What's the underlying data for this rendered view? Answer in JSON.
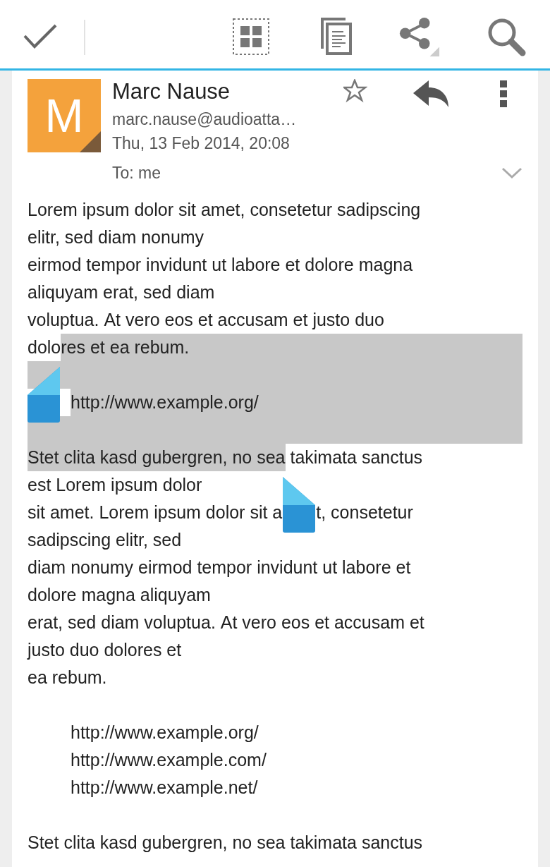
{
  "message": {
    "sender_name": "Marc Nause",
    "avatar_initial": "M",
    "email": "marc.nause@audioatta…",
    "date": "Thu, 13 Feb 2014, 20:08",
    "recipients": "To: me",
    "starred": false
  },
  "body": [
    {
      "kind": "text",
      "segments": [
        {
          "text": "Lorem ipsum dolor sit amet, consetetur sadipscing",
          "selected": false
        }
      ]
    },
    {
      "kind": "text",
      "segments": [
        {
          "text": "elitr, sed diam nonumy",
          "selected": false
        }
      ]
    },
    {
      "kind": "text",
      "segments": [
        {
          "text": "eirmod tempor invidunt ut labore et dolore magna",
          "selected": false
        }
      ]
    },
    {
      "kind": "text",
      "segments": [
        {
          "text": "aliquyam erat, sed diam",
          "selected": false
        }
      ]
    },
    {
      "kind": "text",
      "segments": [
        {
          "text": "voluptua. At vero eos et accusam et justo duo",
          "selected": false
        }
      ]
    },
    {
      "kind": "text",
      "segments": [
        {
          "text": "dolo",
          "selected": false
        },
        {
          "text": "res et ea rebum.",
          "selected": true
        }
      ]
    },
    {
      "kind": "gap",
      "selected": true
    },
    {
      "kind": "url",
      "segments": [
        {
          "text": "http://www.example.org/",
          "selected": true
        }
      ]
    },
    {
      "kind": "gap",
      "selected": true
    },
    {
      "kind": "text",
      "segments": [
        {
          "text": "Stet clita kasd gubergren, no sea",
          "selected": true
        },
        {
          "text": " takimata sanctus",
          "selected": false
        }
      ]
    },
    {
      "kind": "text",
      "segments": [
        {
          "text": "est Lorem ipsum dolor",
          "selected": false
        }
      ]
    },
    {
      "kind": "text",
      "segments": [
        {
          "text": "sit amet. Lorem ipsum dolor sit a",
          "selected": false
        },
        {
          "text": "t, consetetur",
          "selected": false,
          "gap_before": true
        }
      ]
    },
    {
      "kind": "text",
      "segments": [
        {
          "text": "sadipscing elitr, sed",
          "selected": false
        }
      ]
    },
    {
      "kind": "text",
      "segments": [
        {
          "text": "diam nonumy eirmod tempor invidunt ut labore et",
          "selected": false
        }
      ]
    },
    {
      "kind": "text",
      "segments": [
        {
          "text": "dolore magna aliquyam",
          "selected": false
        }
      ]
    },
    {
      "kind": "text",
      "segments": [
        {
          "text": "erat, sed diam voluptua. At vero eos et accusam et",
          "selected": false
        }
      ]
    },
    {
      "kind": "text",
      "segments": [
        {
          "text": "justo duo dolores et",
          "selected": false
        }
      ]
    },
    {
      "kind": "text",
      "segments": [
        {
          "text": "ea rebum.",
          "selected": false
        }
      ]
    },
    {
      "kind": "gap",
      "selected": false
    },
    {
      "kind": "url",
      "segments": [
        {
          "text": "http://www.example.org/",
          "selected": false
        }
      ]
    },
    {
      "kind": "url",
      "segments": [
        {
          "text": "http://www.example.com/",
          "selected": false
        }
      ]
    },
    {
      "kind": "url",
      "segments": [
        {
          "text": "http://www.example.net/",
          "selected": false
        }
      ]
    },
    {
      "kind": "gap",
      "selected": false
    },
    {
      "kind": "text",
      "segments": [
        {
          "text": "Stet clita kasd gubergren, no sea takimata sanctus",
          "selected": false
        }
      ]
    }
  ]
}
